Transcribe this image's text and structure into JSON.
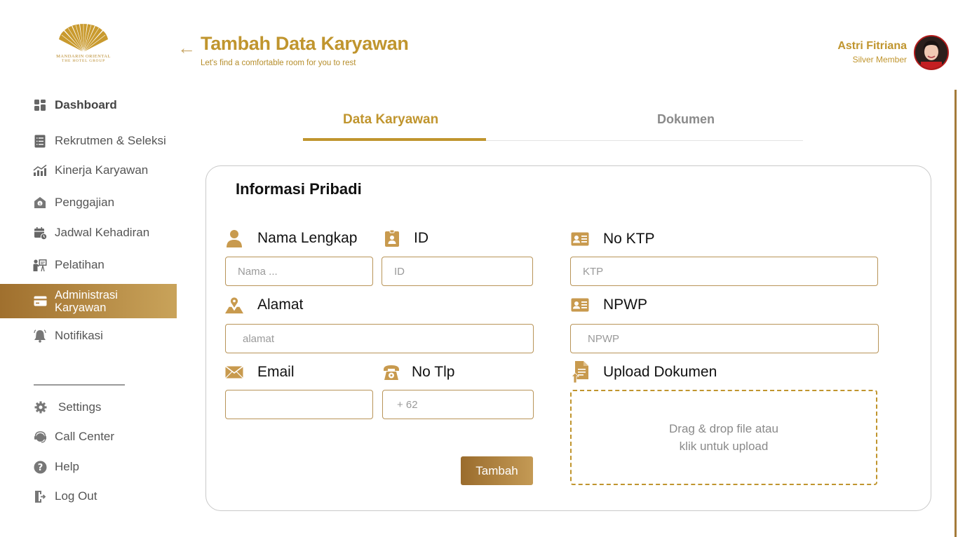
{
  "brand": {
    "line1": "MANDARIN ORIENTAL",
    "line2": "THE HOTEL GROUP"
  },
  "header": {
    "title": "Tambah Data Karyawan",
    "subtitle": "Let's find a comfortable room for you to rest"
  },
  "user": {
    "name": "Astri Fitriana",
    "tier": "Silver Member"
  },
  "sidebar": {
    "items": [
      {
        "label": "Dashboard",
        "icon": "dashboard-grid-icon"
      },
      {
        "label": "Rekrutmen & Seleksi",
        "icon": "list-document-icon"
      },
      {
        "label": "Kinerja Karyawan",
        "icon": "chart-trend-icon"
      },
      {
        "label": "Penggajian",
        "icon": "payroll-icon"
      },
      {
        "label": "Jadwal Kehadiran",
        "icon": "calendar-clock-icon"
      },
      {
        "label": "Pelatihan",
        "icon": "training-board-icon"
      },
      {
        "label": "Administrasi Karyawan",
        "icon": "card-icon",
        "active": true
      },
      {
        "label": "Notifikasi",
        "icon": "bell-icon"
      }
    ],
    "bottom": [
      {
        "label": "Settings",
        "icon": "gear-icon"
      },
      {
        "label": "Call Center",
        "icon": "headset-icon"
      },
      {
        "label": "Help",
        "icon": "question-icon"
      },
      {
        "label": "Log Out",
        "icon": "logout-icon"
      }
    ]
  },
  "tabs": [
    {
      "label": "Data Karyawan",
      "active": true
    },
    {
      "label": "Dokumen",
      "active": false
    }
  ],
  "form": {
    "section_title": "Informasi Pribadi",
    "fields": {
      "nama": {
        "label": "Nama Lengkap",
        "placeholder": "Nama ...",
        "value": ""
      },
      "id": {
        "label": "ID",
        "placeholder": "ID",
        "value": ""
      },
      "ktp": {
        "label": "No KTP",
        "placeholder": "KTP",
        "value": ""
      },
      "alamat": {
        "label": "Alamat",
        "placeholder": "alamat",
        "value": ""
      },
      "npwp": {
        "label": "NPWP",
        "placeholder": "NPWP",
        "value": ""
      },
      "email": {
        "label": "Email",
        "placeholder": "",
        "value": ""
      },
      "tlp": {
        "label": "No Tlp",
        "placeholder": "+ 62",
        "value": ""
      }
    },
    "upload": {
      "label": "Upload Dokumen",
      "hint_line1": "Drag & drop file atau",
      "hint_line2": "klik untuk upload"
    },
    "submit_label": "Tambah"
  },
  "colors": {
    "accent": "#c0952e",
    "accent_dark": "#9a6c2d",
    "input_border": "#b89458"
  }
}
